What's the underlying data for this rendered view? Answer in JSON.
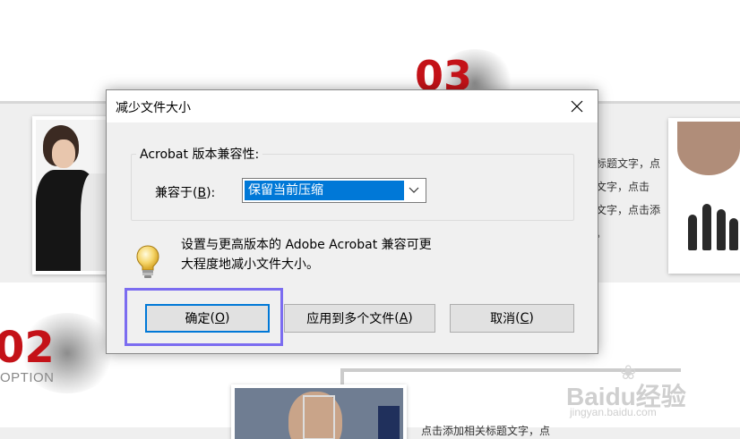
{
  "background": {
    "big_number_top": "03",
    "big_number_left": "02",
    "option_text": "OPTION",
    "right_text_lines": [
      "标题文字，点",
      "文字，点击",
      "文字，点击添",
      "。"
    ],
    "bottom_text": "点击添加相关标题文字，点",
    "watermark": {
      "main": "Baidu经验",
      "sub": "jingyan.baidu.com"
    }
  },
  "dialog": {
    "title": "减少文件大小",
    "close_icon": "close-icon",
    "group_legend": "Acrobat 版本兼容性:",
    "compat_label": "兼容于",
    "compat_mnemonic": "B",
    "compat_selected": "保留当前压缩",
    "info_icon": "lightbulb-icon",
    "info_text_line1": "设置与更高版本的 Adobe Acrobat 兼容可更",
    "info_text_line2": "大程度地减小文件大小。",
    "buttons": {
      "ok_label": "确定",
      "ok_mnemonic": "O",
      "apply_label": "应用到多个文件",
      "apply_mnemonic": "A",
      "cancel_label": "取消",
      "cancel_mnemonic": "C"
    }
  },
  "colors": {
    "accent_red": "#c41218",
    "selection_blue": "#0078d7",
    "highlight_purple": "#7b6cf0"
  }
}
